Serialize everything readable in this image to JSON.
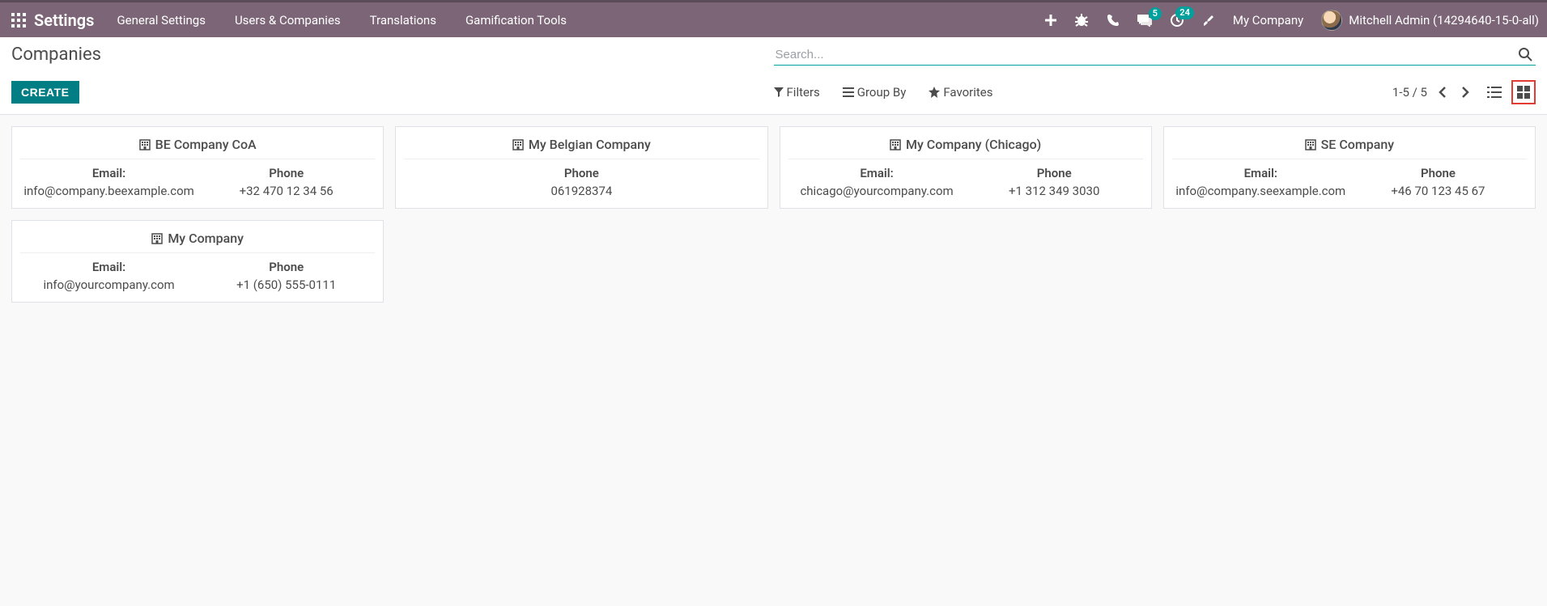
{
  "nav": {
    "brand": "Settings",
    "menu": [
      "General Settings",
      "Users & Companies",
      "Translations",
      "Gamification Tools"
    ],
    "messaging_badge": "5",
    "activities_badge": "24",
    "company": "My Company",
    "user": "Mitchell Admin (14294640-15-0-all)"
  },
  "cp": {
    "title": "Companies",
    "search_placeholder": "Search...",
    "create": "CREATE",
    "filters": "Filters",
    "groupby": "Group By",
    "favorites": "Favorites",
    "pager": "1-5 / 5"
  },
  "labels": {
    "email": "Email:",
    "phone": "Phone"
  },
  "companies": [
    {
      "name": "BE Company CoA",
      "email": "info@company.beexample.com",
      "phone": "+32 470 12 34 56"
    },
    {
      "name": "My Belgian Company",
      "email": "",
      "phone": "061928374"
    },
    {
      "name": "My Company (Chicago)",
      "email": "chicago@yourcompany.com",
      "phone": "+1 312 349 3030"
    },
    {
      "name": "SE Company",
      "email": "info@company.seexample.com",
      "phone": "+46 70 123 45 67"
    },
    {
      "name": "My Company",
      "email": "info@yourcompany.com",
      "phone": "+1 (650) 555-0111"
    }
  ]
}
